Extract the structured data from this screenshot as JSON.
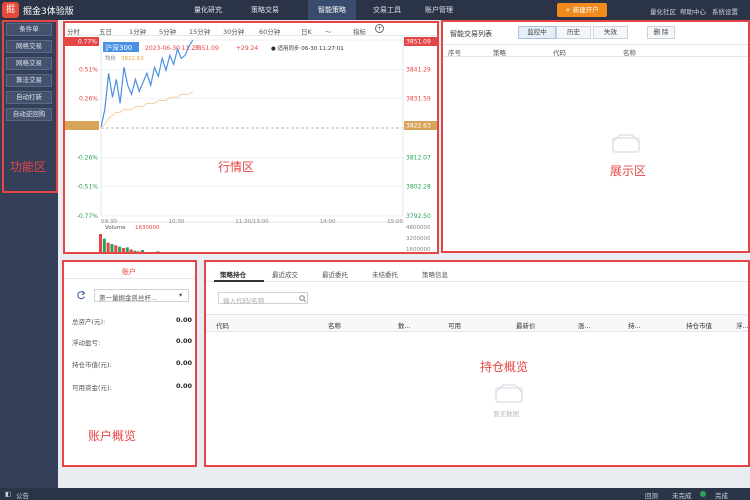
{
  "app": {
    "name": "掘金3体验版",
    "logo": "掘"
  },
  "nav": [
    {
      "label": "量化研究",
      "active": false
    },
    {
      "label": "策略交易",
      "active": false
    },
    {
      "label": "智能策略",
      "active": true
    },
    {
      "label": "交易工具",
      "active": false
    },
    {
      "label": "账户管理",
      "active": false
    }
  ],
  "header": {
    "cta_label": "+ 新建开户",
    "links": [
      "量化社区",
      "帮助中心",
      "系统设置"
    ]
  },
  "sidebar": {
    "items": [
      "条件单",
      "网格交易",
      "网格交易",
      "算法交易",
      "自动打新",
      "自动逆回购"
    ],
    "annotation": "功能区"
  },
  "market": {
    "periods": [
      "分时",
      "五日",
      "1分钟",
      "5分钟",
      "15分钟",
      "30分钟",
      "60分钟",
      "日K",
      "〜",
      "指标"
    ],
    "symbol": "沪深300",
    "timestamp": "2023-06-30 11:27",
    "price": "3851.09",
    "change": "+29.24",
    "status": "● 适用同步 06-30 11:27:01",
    "sub_label": "均价",
    "avg_value": "3822.63",
    "left_axis": [
      "0.77%",
      "0.51%",
      "0.26%",
      "0.00%",
      "-0.26%",
      "-0.51%",
      "-0.77%"
    ],
    "right_axis": [
      "3851.09",
      "3841.29",
      "3831.59",
      "3821.84",
      "3812.07",
      "3802.28",
      "3792.50"
    ],
    "volume_label": "Volume",
    "volume_value": "1630000",
    "vol_axis": [
      "4800000",
      "3200000",
      "1600000",
      "1630000"
    ],
    "time_axis": [
      "09:30",
      "10:30",
      "11:30/13:00",
      "14:00",
      "15:00"
    ],
    "annotation": "行情区"
  },
  "chart_data": {
    "type": "line",
    "title": "沪深300",
    "x": [
      "09:30",
      "09:35",
      "09:40",
      "09:45",
      "09:50",
      "09:55",
      "10:00",
      "10:05",
      "10:10",
      "10:15",
      "10:20",
      "10:25",
      "10:30",
      "10:35",
      "10:40",
      "10:45",
      "10:50",
      "10:55",
      "11:00",
      "11:05",
      "11:10",
      "11:15",
      "11:20",
      "11:25",
      "11:27"
    ],
    "series": [
      {
        "values": [
          3822,
          3828,
          3840,
          3832,
          3838,
          3830,
          3842,
          3836,
          3833,
          3838,
          3834,
          3837,
          3840,
          3836,
          3842,
          3839,
          3845,
          3841,
          3846,
          3843,
          3848,
          3845,
          3846,
          3849,
          3851
        ]
      },
      {
        "values": [
          3822,
          3823,
          3825,
          3826,
          3827,
          3827,
          3828,
          3828,
          3828,
          3829,
          3829,
          3829,
          3830,
          3830,
          3830,
          3831,
          3831,
          3831,
          3832,
          3832,
          3832,
          3833,
          3833,
          3833,
          3834
        ]
      }
    ],
    "volume": [
      4.5,
      3.8,
      3.2,
      3.0,
      2.8,
      2.6,
      2.4,
      2.5,
      2.2,
      2.0,
      1.9,
      2.1,
      1.8,
      1.7,
      1.6,
      1.9,
      1.5,
      1.4,
      1.6,
      1.3,
      1.2,
      1.4,
      1.1,
      1.2,
      1.6
    ],
    "ylim": [
      3792.5,
      3851.09
    ]
  },
  "display": {
    "title": "智能交易列表",
    "filters": [
      "监控中",
      "历史",
      "失效"
    ],
    "delete_label": "删 除",
    "columns": [
      "序号",
      "策略",
      "代码",
      "名称"
    ],
    "annotation": "展示区"
  },
  "account": {
    "title": "账户",
    "selector": "第一量掘金凯丝杆...",
    "rows": [
      {
        "label": "总资产(元):",
        "value": "0.00"
      },
      {
        "label": "浮动盈亏:",
        "value": "0.00"
      },
      {
        "label": "持仓市值(元):",
        "value": "0.00"
      },
      {
        "label": "可用资金(元):",
        "value": "0.00"
      }
    ],
    "annotation": "账户概览"
  },
  "positions": {
    "tabs": [
      "策略持仓",
      "最近成交",
      "最近委托",
      "未结委托",
      "策略信息"
    ],
    "search_placeholder": "输入代码/名称",
    "columns": [
      "代码",
      "名称",
      "数...",
      "可用",
      "最新价",
      "涨...",
      "持...",
      "持仓市值",
      "浮..."
    ],
    "empty_text": "暂无数据",
    "annotation": "持仓概览"
  },
  "status": {
    "left": "公告",
    "right": [
      "回测",
      "未完成",
      "完成"
    ]
  },
  "colors": {
    "accent_red": "#e64545",
    "nav_bg": "#2b3446",
    "price_up": "#e64545",
    "price_down": "#2aa05a"
  }
}
